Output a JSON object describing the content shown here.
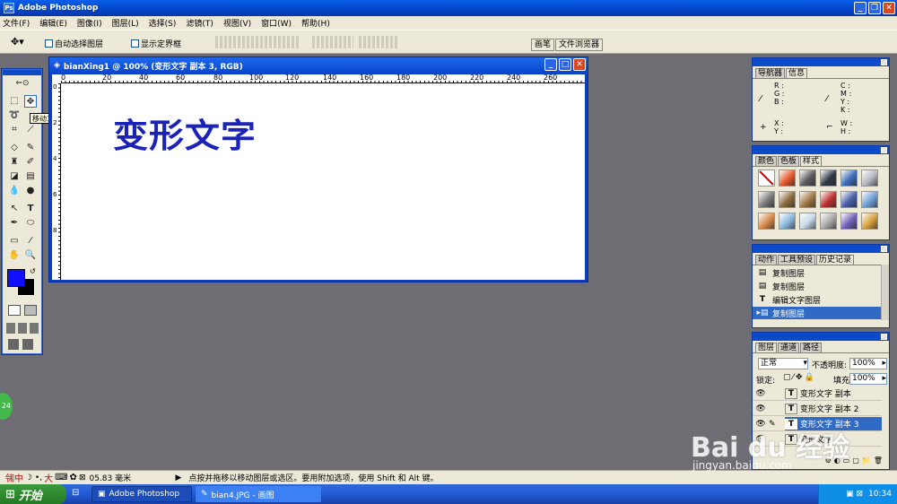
{
  "app": {
    "title": "Adobe Photoshop"
  },
  "menu": [
    "文件(F)",
    "编辑(E)",
    "图像(I)",
    "图层(L)",
    "选择(S)",
    "滤镜(T)",
    "视图(V)",
    "窗口(W)",
    "帮助(H)"
  ],
  "options": {
    "auto_select": "自动选择图层",
    "show_bounds": "显示定界框"
  },
  "palette_well": {
    "brushes": "画笔",
    "file_browser": "文件浏览器"
  },
  "tooltip": "移动工具(V)",
  "document": {
    "title": "bianXing1 @ 100% (变形文字 副本 3, RGB)",
    "ruler_labels": [
      "0",
      "20",
      "40",
      "60",
      "80",
      "100",
      "120",
      "140",
      "160",
      "180",
      "200",
      "220",
      "240",
      "260"
    ],
    "vruler_labels": [
      "0",
      "2",
      "4",
      "6",
      "8"
    ],
    "canvas_text": "变形文字"
  },
  "navigator_panel": {
    "tabs": [
      "导航器",
      "信息"
    ],
    "rgb_labels": [
      "R :",
      "G :",
      "B :"
    ],
    "cmyk_labels": [
      "C :",
      "M :",
      "Y :",
      "K :"
    ],
    "xy_labels": [
      "X :",
      "Y :"
    ],
    "wh_labels": [
      "W :",
      "H :"
    ]
  },
  "swatches_panel": {
    "tabs": [
      "颜色",
      "色板",
      "样式"
    ],
    "colors": [
      "#ffffff",
      "#e8582c",
      "#5a5a5a",
      "#303848",
      "#3d6db8",
      "#b4b8c0",
      "#7a7a7a",
      "#8c6a3c",
      "#a07846",
      "#c03030",
      "#4a60a8",
      "#70a0d8",
      "#d88a4a",
      "#8cb8e0",
      "#c8d8e8",
      "#a8a8a8",
      "#7060b8",
      "#d8a040"
    ]
  },
  "history_panel": {
    "tabs": [
      "动作",
      "工具预设",
      "历史记录"
    ],
    "items": [
      "复制图层",
      "复制图层",
      "编辑文字图层",
      "复制图层"
    ]
  },
  "layers_panel": {
    "tabs": [
      "图层",
      "通道",
      "路径"
    ],
    "blend_mode": "正常",
    "opacity_label": "不透明度:",
    "opacity_value": "100%",
    "lock_label": "锁定:",
    "fill_label": "填充:",
    "fill_value": "100%",
    "layers": [
      "变形文字 副本",
      "变形文字 副本 2",
      "变形文字 副本 3",
      "变形文字"
    ]
  },
  "status": {
    "size": "05.83 毫米",
    "hint": "点按并拖移以移动图层或选区。要用附加选项，使用 Shift 和 Alt 键。"
  },
  "taskbar": {
    "start": "开始",
    "tasks": [
      "Adobe Photoshop",
      "bian4.JPG - 画图"
    ],
    "time": "10:34"
  },
  "ime": {
    "mode": "中"
  },
  "watermark": {
    "brand": "Bai du 经验",
    "url": "jingyan.baidu.com"
  },
  "bubble": "24"
}
